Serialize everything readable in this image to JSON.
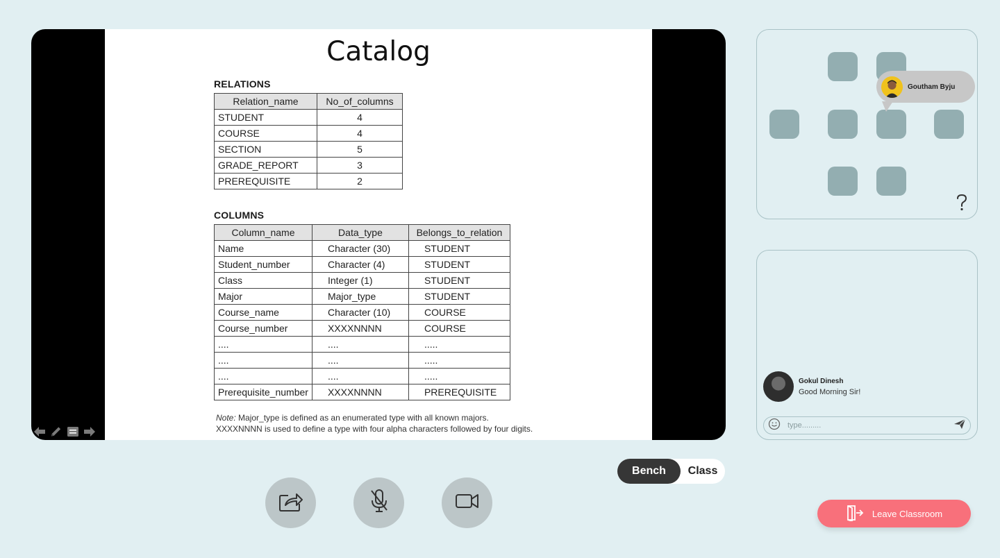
{
  "slide": {
    "title": "Catalog",
    "relations_heading": "RELATIONS",
    "relations_headers": [
      "Relation_name",
      "No_of_columns"
    ],
    "relations_rows": [
      [
        "STUDENT",
        "4"
      ],
      [
        "COURSE",
        "4"
      ],
      [
        "SECTION",
        "5"
      ],
      [
        "GRADE_REPORT",
        "3"
      ],
      [
        "PREREQUISITE",
        "2"
      ]
    ],
    "columns_heading": "COLUMNS",
    "columns_headers": [
      "Column_name",
      "Data_type",
      "Belongs_to_relation"
    ],
    "columns_rows": [
      [
        "Name",
        "Character (30)",
        "STUDENT"
      ],
      [
        "Student_number",
        "Character (4)",
        "STUDENT"
      ],
      [
        "Class",
        "Integer (1)",
        "STUDENT"
      ],
      [
        "Major",
        "Major_type",
        "STUDENT"
      ],
      [
        "Course_name",
        "Character (10)",
        "COURSE"
      ],
      [
        "Course_number",
        "XXXXNNNN",
        "COURSE"
      ],
      [
        "....",
        "....",
        "....."
      ],
      [
        "....",
        "....",
        "....."
      ],
      [
        "....",
        "....",
        "....."
      ],
      [
        "Prerequisite_number",
        "XXXXNNNN",
        "PREREQUISITE"
      ]
    ],
    "note_label": "Note:",
    "note_line1": " Major_type is defined as an enumerated type with all known majors.",
    "note_line2": "XXXXNNNN is used to define a type with four alpha characters followed by four digits."
  },
  "slide_tools": [
    "arrow-left-icon",
    "pencil-icon",
    "notes-icon",
    "arrow-right-icon"
  ],
  "seats": {
    "hover_user": "Goutham Byju",
    "help_icon": "question-mark-icon"
  },
  "chat": {
    "messages": [
      {
        "sender": "Gokul Dinesh",
        "text": "Good Morning Sir!"
      }
    ],
    "input_placeholder": "type.........",
    "emoji_icon": "smiley-icon",
    "send_icon": "send-icon"
  },
  "view_toggle": {
    "active": "Bench",
    "inactive": "Class"
  },
  "controls": [
    "share-screen-icon",
    "mic-off-icon",
    "video-camera-icon"
  ],
  "leave_button": "Leave Classroom",
  "colors": {
    "background": "#e1eff2",
    "seat": "#93aeb1",
    "leave": "#f8707b",
    "control": "#bcc6c8",
    "toggle_active": "#363636"
  }
}
